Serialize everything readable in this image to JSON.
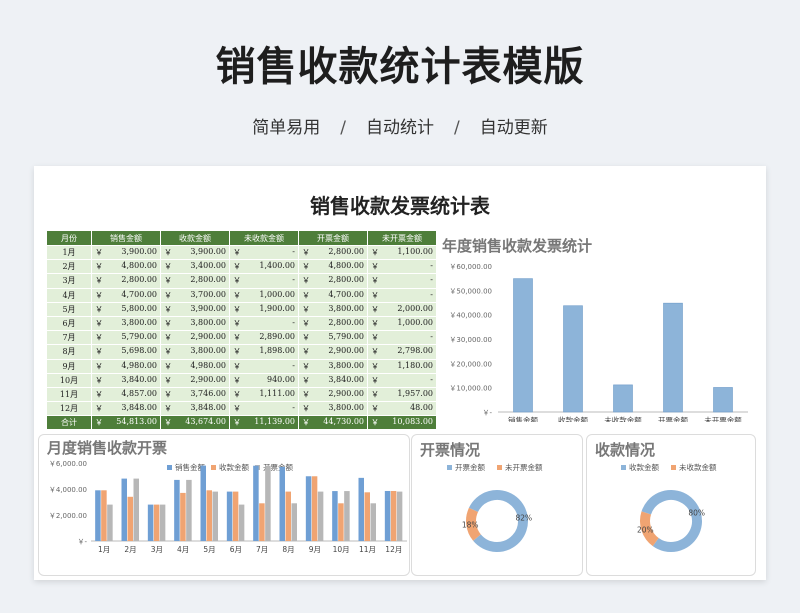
{
  "header": {
    "title": "销售收款统计表模版",
    "subtitle": [
      "简单易用",
      "自动统计",
      "自动更新"
    ],
    "sep": "/"
  },
  "sheet": {
    "title": "销售收款发票统计表"
  },
  "table": {
    "columns": [
      "月份",
      "销售金额",
      "收款金额",
      "未收款金额",
      "开票金额",
      "未开票金额"
    ],
    "currency": "￥",
    "rows": [
      [
        "1月",
        "3,900.00",
        "3,900.00",
        "-",
        "2,800.00",
        "1,100.00"
      ],
      [
        "2月",
        "4,800.00",
        "3,400.00",
        "1,400.00",
        "4,800.00",
        "-"
      ],
      [
        "3月",
        "2,800.00",
        "2,800.00",
        "-",
        "2,800.00",
        "-"
      ],
      [
        "4月",
        "4,700.00",
        "3,700.00",
        "1,000.00",
        "4,700.00",
        "-"
      ],
      [
        "5月",
        "5,800.00",
        "3,900.00",
        "1,900.00",
        "3,800.00",
        "2,000.00"
      ],
      [
        "6月",
        "3,800.00",
        "3,800.00",
        "-",
        "2,800.00",
        "1,000.00"
      ],
      [
        "7月",
        "5,790.00",
        "2,900.00",
        "2,890.00",
        "5,790.00",
        "-"
      ],
      [
        "8月",
        "5,698.00",
        "3,800.00",
        "1,898.00",
        "2,900.00",
        "2,798.00"
      ],
      [
        "9月",
        "4,980.00",
        "4,980.00",
        "-",
        "3,800.00",
        "1,180.00"
      ],
      [
        "10月",
        "3,840.00",
        "2,900.00",
        "940.00",
        "3,840.00",
        "-"
      ],
      [
        "11月",
        "4,857.00",
        "3,746.00",
        "1,111.00",
        "2,900.00",
        "1,957.00"
      ],
      [
        "12月",
        "3,848.00",
        "3,848.00",
        "-",
        "3,800.00",
        "48.00"
      ]
    ],
    "total": [
      "合计",
      "54,813.00",
      "43,674.00",
      "11,139.00",
      "44,730.00",
      "10,083.00"
    ]
  },
  "chart_data": [
    {
      "type": "bar",
      "title": "年度销售收款发票统计",
      "categories": [
        "销售金额",
        "收款金额",
        "未收款金额",
        "开票金额",
        "未开票金额"
      ],
      "values": [
        54813,
        43674,
        11139,
        44730,
        10083
      ],
      "ylim": [
        0,
        60000
      ],
      "yticks": [
        "￥60,000.00",
        "￥50,000.00",
        "￥40,000.00",
        "￥30,000.00",
        "￥20,000.00",
        "￥10,000.00",
        "￥-"
      ],
      "color": "#8db4d9"
    },
    {
      "type": "bar",
      "title": "月度销售收款开票",
      "categories": [
        "1月",
        "2月",
        "3月",
        "4月",
        "5月",
        "6月",
        "7月",
        "8月",
        "9月",
        "10月",
        "11月",
        "12月"
      ],
      "series": [
        {
          "name": "销售金额",
          "color": "#6f9fd4",
          "values": [
            3900,
            4800,
            2800,
            4700,
            5800,
            3800,
            5790,
            5698,
            4980,
            3840,
            4857,
            3848
          ]
        },
        {
          "name": "收款金额",
          "color": "#f0a472",
          "values": [
            3900,
            3400,
            2800,
            3700,
            3900,
            3800,
            2900,
            3800,
            4980,
            2900,
            3746,
            3848
          ]
        },
        {
          "name": "开票金额",
          "color": "#b7b7b7",
          "values": [
            2800,
            4800,
            2800,
            4700,
            3800,
            2800,
            5790,
            2900,
            3800,
            3840,
            2900,
            3800
          ]
        }
      ],
      "ylim": [
        0,
        6000
      ],
      "yticks": [
        "￥6,000.00",
        "￥4,000.00",
        "￥2,000.00",
        "￥-"
      ]
    },
    {
      "type": "pie",
      "title": "开票情况",
      "labels": [
        "开票金额",
        "未开票金额"
      ],
      "values": [
        82,
        18
      ],
      "value_labels": [
        "82%",
        "18%"
      ],
      "colors": [
        "#8db4d9",
        "#f0a472"
      ]
    },
    {
      "type": "pie",
      "title": "收款情况",
      "labels": [
        "收款金额",
        "未收款金额"
      ],
      "values": [
        80,
        20
      ],
      "value_labels": [
        "80%",
        "20%"
      ],
      "colors": [
        "#8db4d9",
        "#f0a472"
      ]
    }
  ]
}
